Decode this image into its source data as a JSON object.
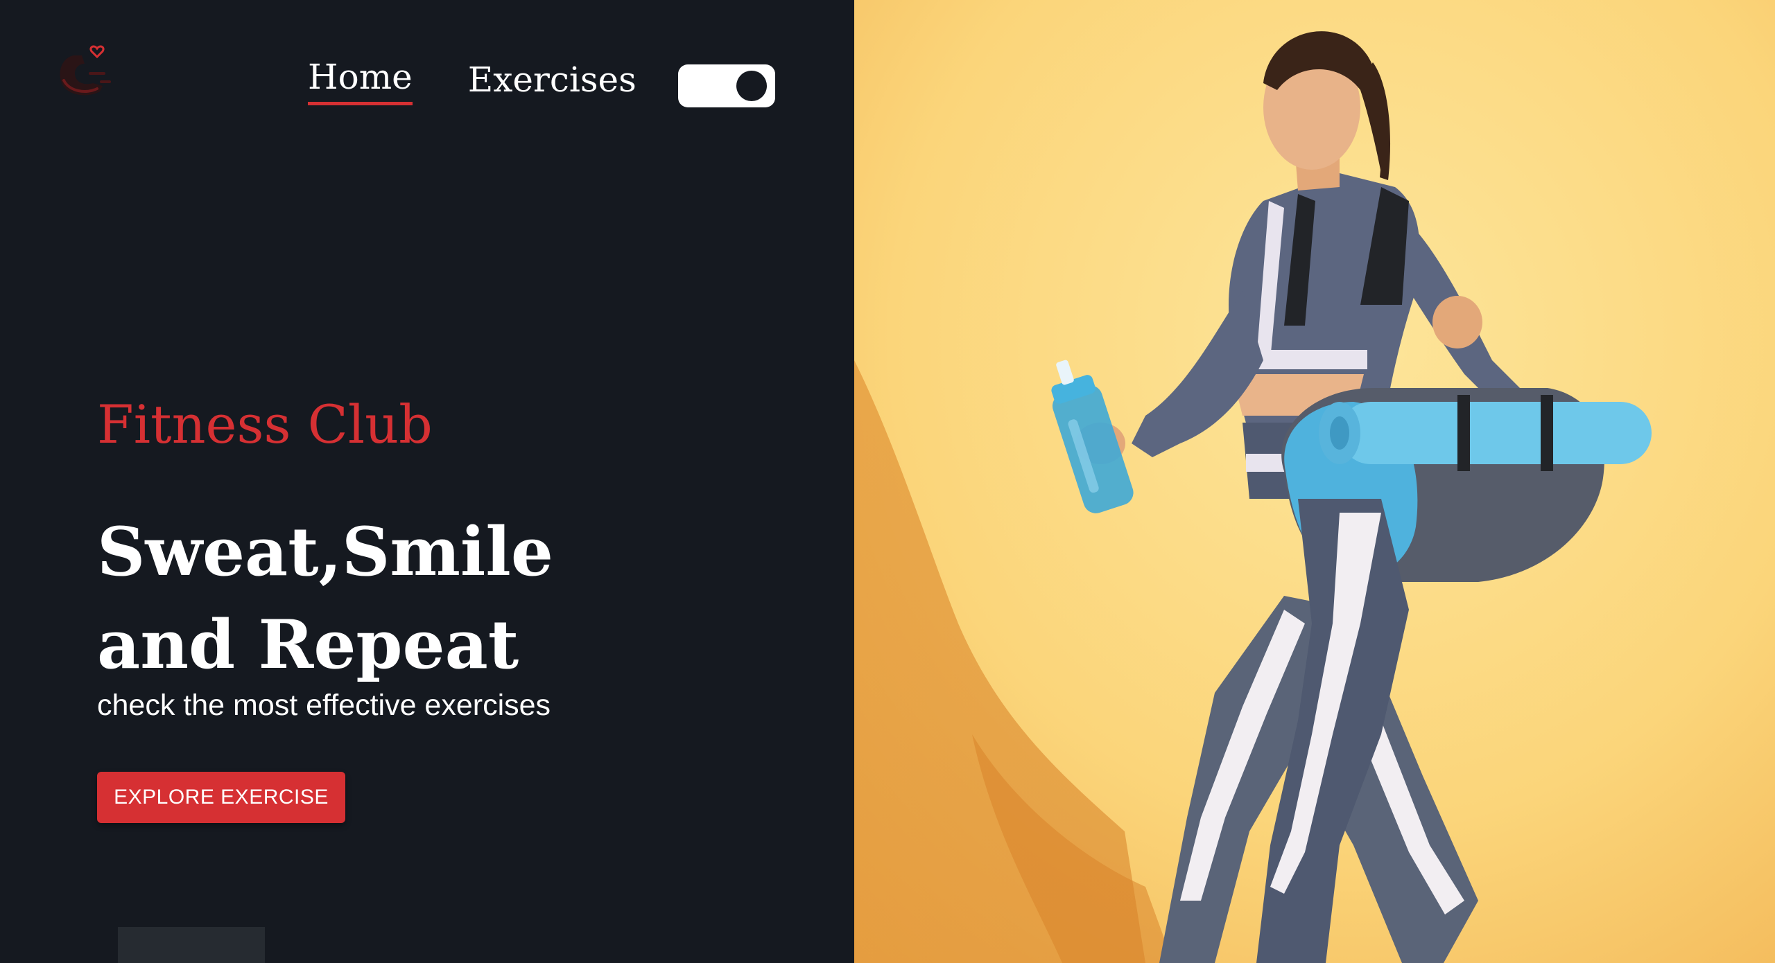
{
  "nav": {
    "home_label": "Home",
    "exercises_label": "Exercises"
  },
  "hero": {
    "eyebrow": "Fitness Club",
    "headline_line1": "Sweat,Smile",
    "headline_line2": "and Repeat",
    "subtitle": "check the most effective exercises",
    "cta_label": "EXPLORE EXERCISE"
  },
  "icons": {
    "logo": "dumbbell-heart-logo",
    "theme_toggle": "toggle-switch"
  },
  "colors": {
    "background": "#151920",
    "accent": "#d63033",
    "text": "#ffffff",
    "hero_background": "#fcd77a"
  }
}
